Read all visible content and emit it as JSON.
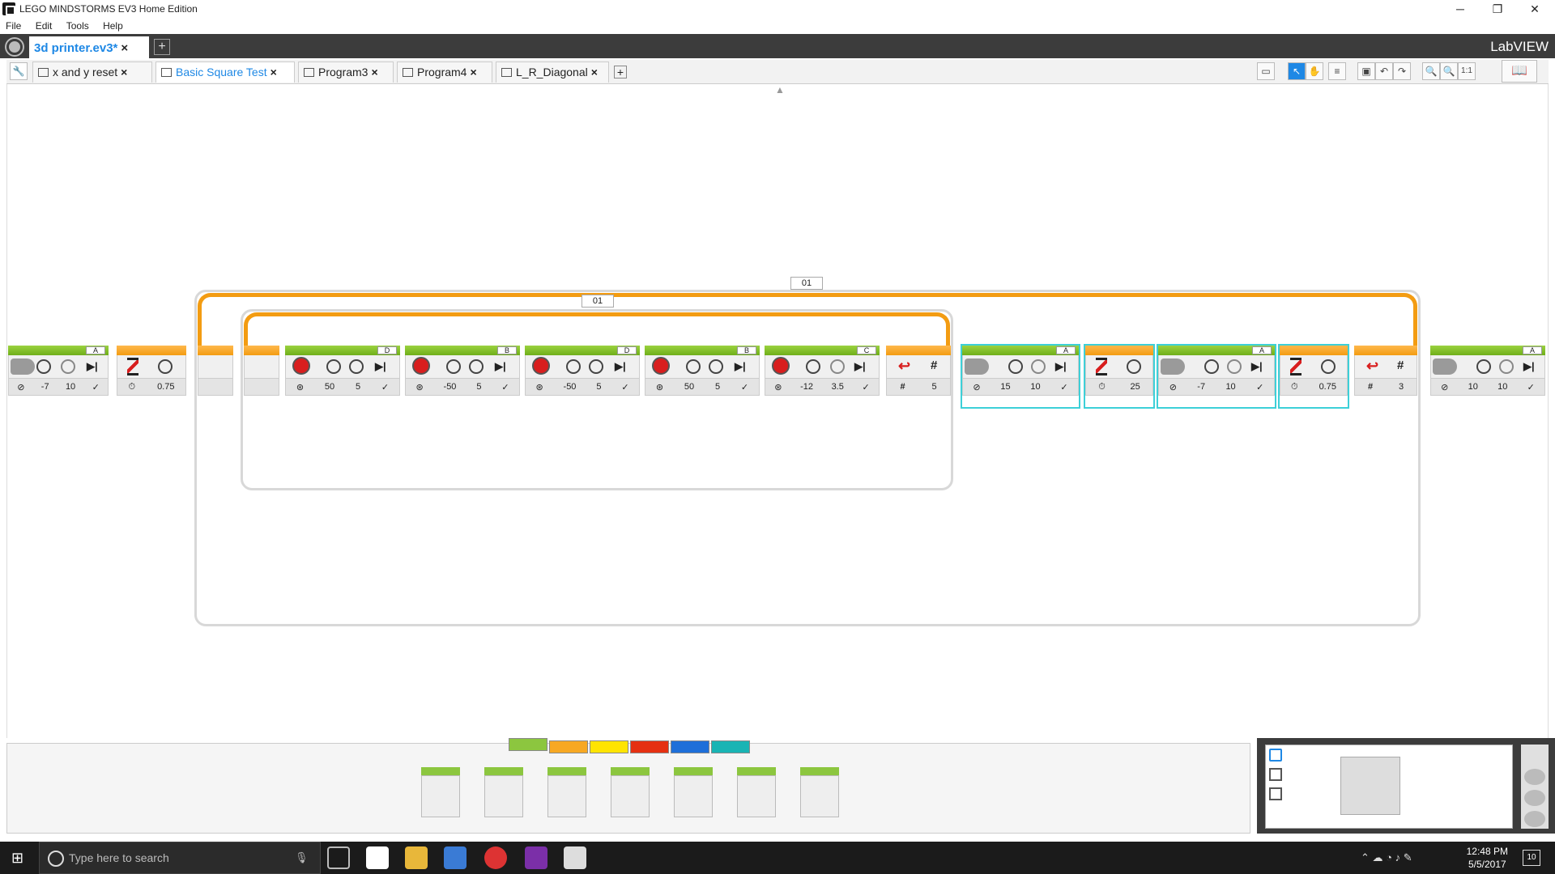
{
  "window": {
    "title": "LEGO MINDSTORMS EV3 Home Edition",
    "minimize": "─",
    "restore": "❐",
    "close": "✕"
  },
  "menu": [
    "File",
    "Edit",
    "Tools",
    "Help"
  ],
  "project_tab": {
    "label": "3d printer.ev3*",
    "close": "×",
    "add": "+"
  },
  "brand": "LabVIEW",
  "program_tabs": [
    {
      "label": "x and y reset"
    },
    {
      "label": "Basic Square Test"
    },
    {
      "label": "Program3"
    },
    {
      "label": "Program4"
    },
    {
      "label": "L_R_Diagonal"
    }
  ],
  "program_tab_add": "+",
  "loops": {
    "outer_counter": "01",
    "inner_counter": "01"
  },
  "blocks": [
    {
      "type": "large-motor",
      "port": "A",
      "values": [
        "-7",
        "10",
        "✓"
      ]
    },
    {
      "type": "wait",
      "values": [
        "0.75"
      ]
    },
    {
      "type": "loop-start-outer",
      "values": []
    },
    {
      "type": "loop-start-inner",
      "values": []
    },
    {
      "type": "medium-motor",
      "port": "D",
      "values": [
        "50",
        "5",
        "✓"
      ]
    },
    {
      "type": "medium-motor",
      "port": "B",
      "values": [
        "-50",
        "5",
        "✓"
      ]
    },
    {
      "type": "medium-motor",
      "port": "D",
      "values": [
        "-50",
        "5",
        "✓"
      ]
    },
    {
      "type": "medium-motor",
      "port": "B",
      "values": [
        "50",
        "5",
        "✓"
      ]
    },
    {
      "type": "medium-motor",
      "port": "C",
      "values": [
        "-12",
        "3.5",
        "✓"
      ]
    },
    {
      "type": "loop-end",
      "values": [
        "#",
        "5"
      ]
    },
    {
      "type": "large-motor",
      "port": "A",
      "values": [
        "15",
        "10",
        "✓"
      ]
    },
    {
      "type": "wait",
      "values": [
        "25"
      ]
    },
    {
      "type": "large-motor",
      "port": "A",
      "values": [
        "-7",
        "10",
        "✓"
      ]
    },
    {
      "type": "wait",
      "values": [
        "0.75"
      ]
    },
    {
      "type": "loop-end",
      "values": [
        "#",
        "3"
      ]
    },
    {
      "type": "large-motor",
      "port": "A",
      "values": [
        "10",
        "10",
        "✓"
      ]
    }
  ],
  "palette_colors": [
    "#8cc63f",
    "#f7a823",
    "#ffe400",
    "#e53012",
    "#1e6fd9",
    "#19b4b4"
  ],
  "taskbar": {
    "search_placeholder": "Type here to search",
    "time": "12:48 PM",
    "date": "5/5/2017",
    "notifications": "10"
  }
}
